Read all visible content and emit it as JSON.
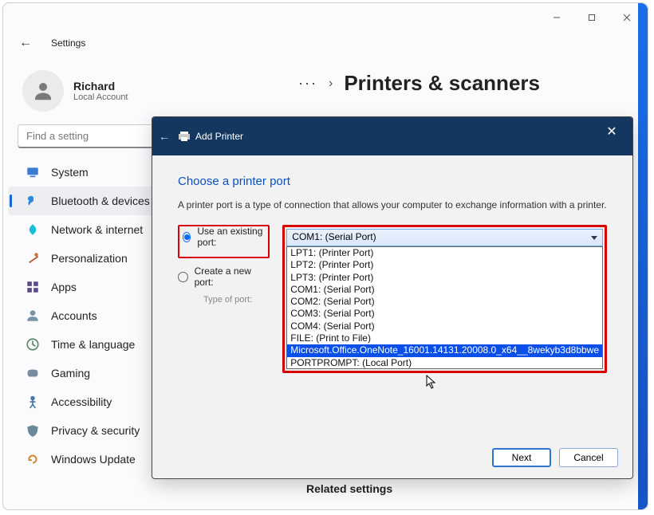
{
  "window": {
    "title": "Settings",
    "user_name": "Richard",
    "user_sub": "Local Account",
    "search_placeholder": "Find a setting"
  },
  "breadcrumb": {
    "dots": "···",
    "title": "Printers & scanners"
  },
  "sidebar": {
    "items": [
      {
        "label": "System"
      },
      {
        "label": "Bluetooth & devices"
      },
      {
        "label": "Network & internet"
      },
      {
        "label": "Personalization"
      },
      {
        "label": "Apps"
      },
      {
        "label": "Accounts"
      },
      {
        "label": "Time & language"
      },
      {
        "label": "Gaming"
      },
      {
        "label": "Accessibility"
      },
      {
        "label": "Privacy & security"
      },
      {
        "label": "Windows Update"
      }
    ],
    "active_index": 1
  },
  "related_heading": "Related settings",
  "dialog": {
    "title": "Add Printer",
    "heading": "Choose a printer port",
    "description": "A printer port is a type of connection that allows your computer to exchange information with a printer.",
    "radio_existing": "Use an existing port:",
    "radio_new": "Create a new port:",
    "type_of_port": "Type of port:",
    "combo_selected": "COM1: (Serial Port)",
    "port_options": [
      "LPT1: (Printer Port)",
      "LPT2: (Printer Port)",
      "LPT3: (Printer Port)",
      "COM1: (Serial Port)",
      "COM2: (Serial Port)",
      "COM3: (Serial Port)",
      "COM4: (Serial Port)",
      "FILE: (Print to File)",
      "Microsoft.Office.OneNote_16001.14131.20008.0_x64__8wekyb3d8bbwe",
      "PORTPROMPT: (Local Port)"
    ],
    "selected_option_index": 8,
    "btn_next": "Next",
    "btn_cancel": "Cancel"
  }
}
